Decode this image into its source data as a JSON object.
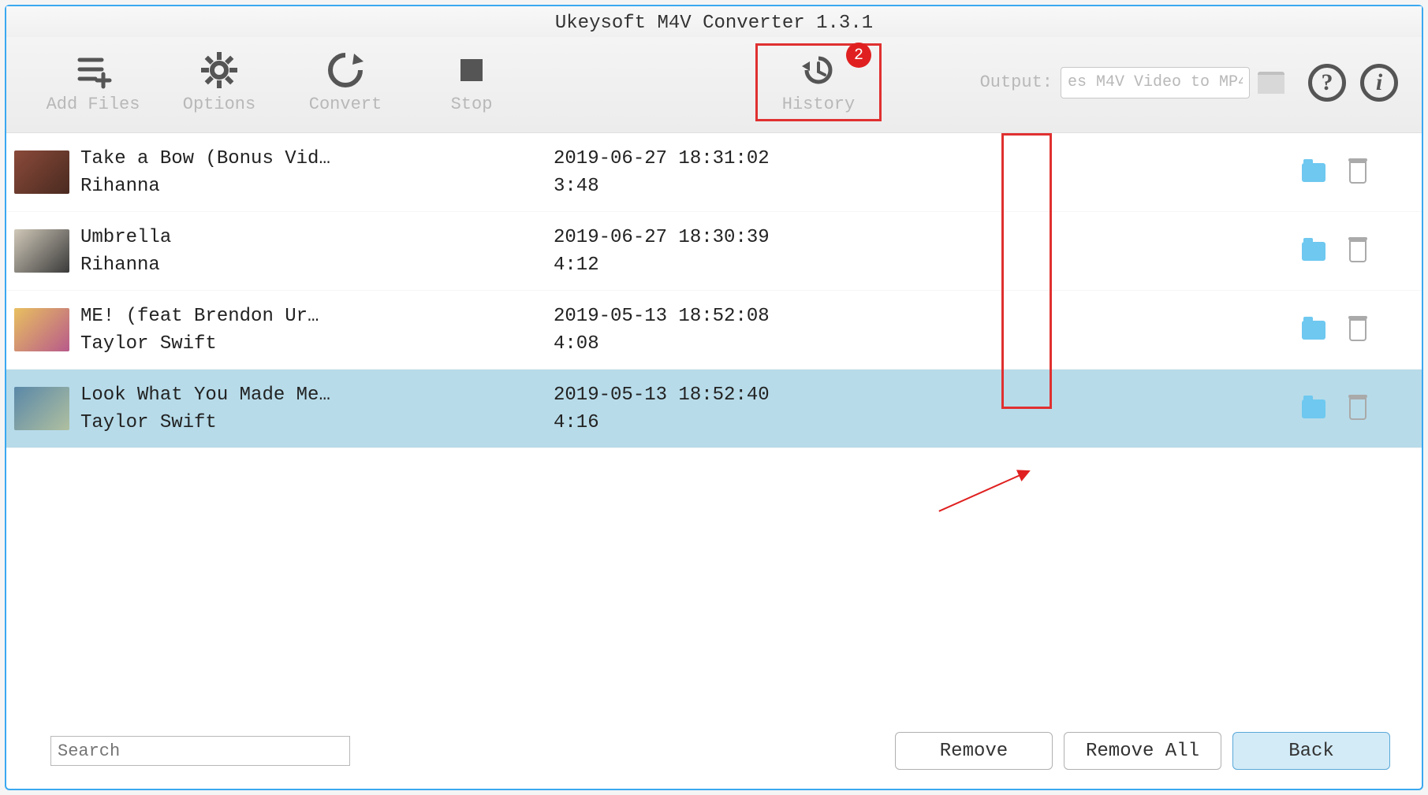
{
  "window": {
    "title": "Ukeysoft M4V Converter 1.3.1"
  },
  "toolbar": {
    "add_files": "Add Files",
    "options": "Options",
    "convert": "Convert",
    "stop": "Stop",
    "history": "History",
    "history_badge": "2",
    "output_label": "Output:",
    "output_value": "es M4V Video to MP4"
  },
  "footer": {
    "search_placeholder": "Search",
    "remove": "Remove",
    "remove_all": "Remove All",
    "back": "Back"
  },
  "rows": [
    {
      "title": "Take a Bow (Bonus Vid…",
      "artist": "Rihanna",
      "date": "2019-06-27 18:31:02",
      "duration": "3:48"
    },
    {
      "title": "Umbrella",
      "artist": "Rihanna",
      "date": "2019-06-27 18:30:39",
      "duration": "4:12"
    },
    {
      "title": "ME! (feat  Brendon Ur…",
      "artist": "Taylor Swift",
      "date": "2019-05-13 18:52:08",
      "duration": "4:08"
    },
    {
      "title": "Look What You Made Me…",
      "artist": "Taylor Swift",
      "date": "2019-05-13 18:52:40",
      "duration": "4:16"
    }
  ],
  "selected_index": 3
}
